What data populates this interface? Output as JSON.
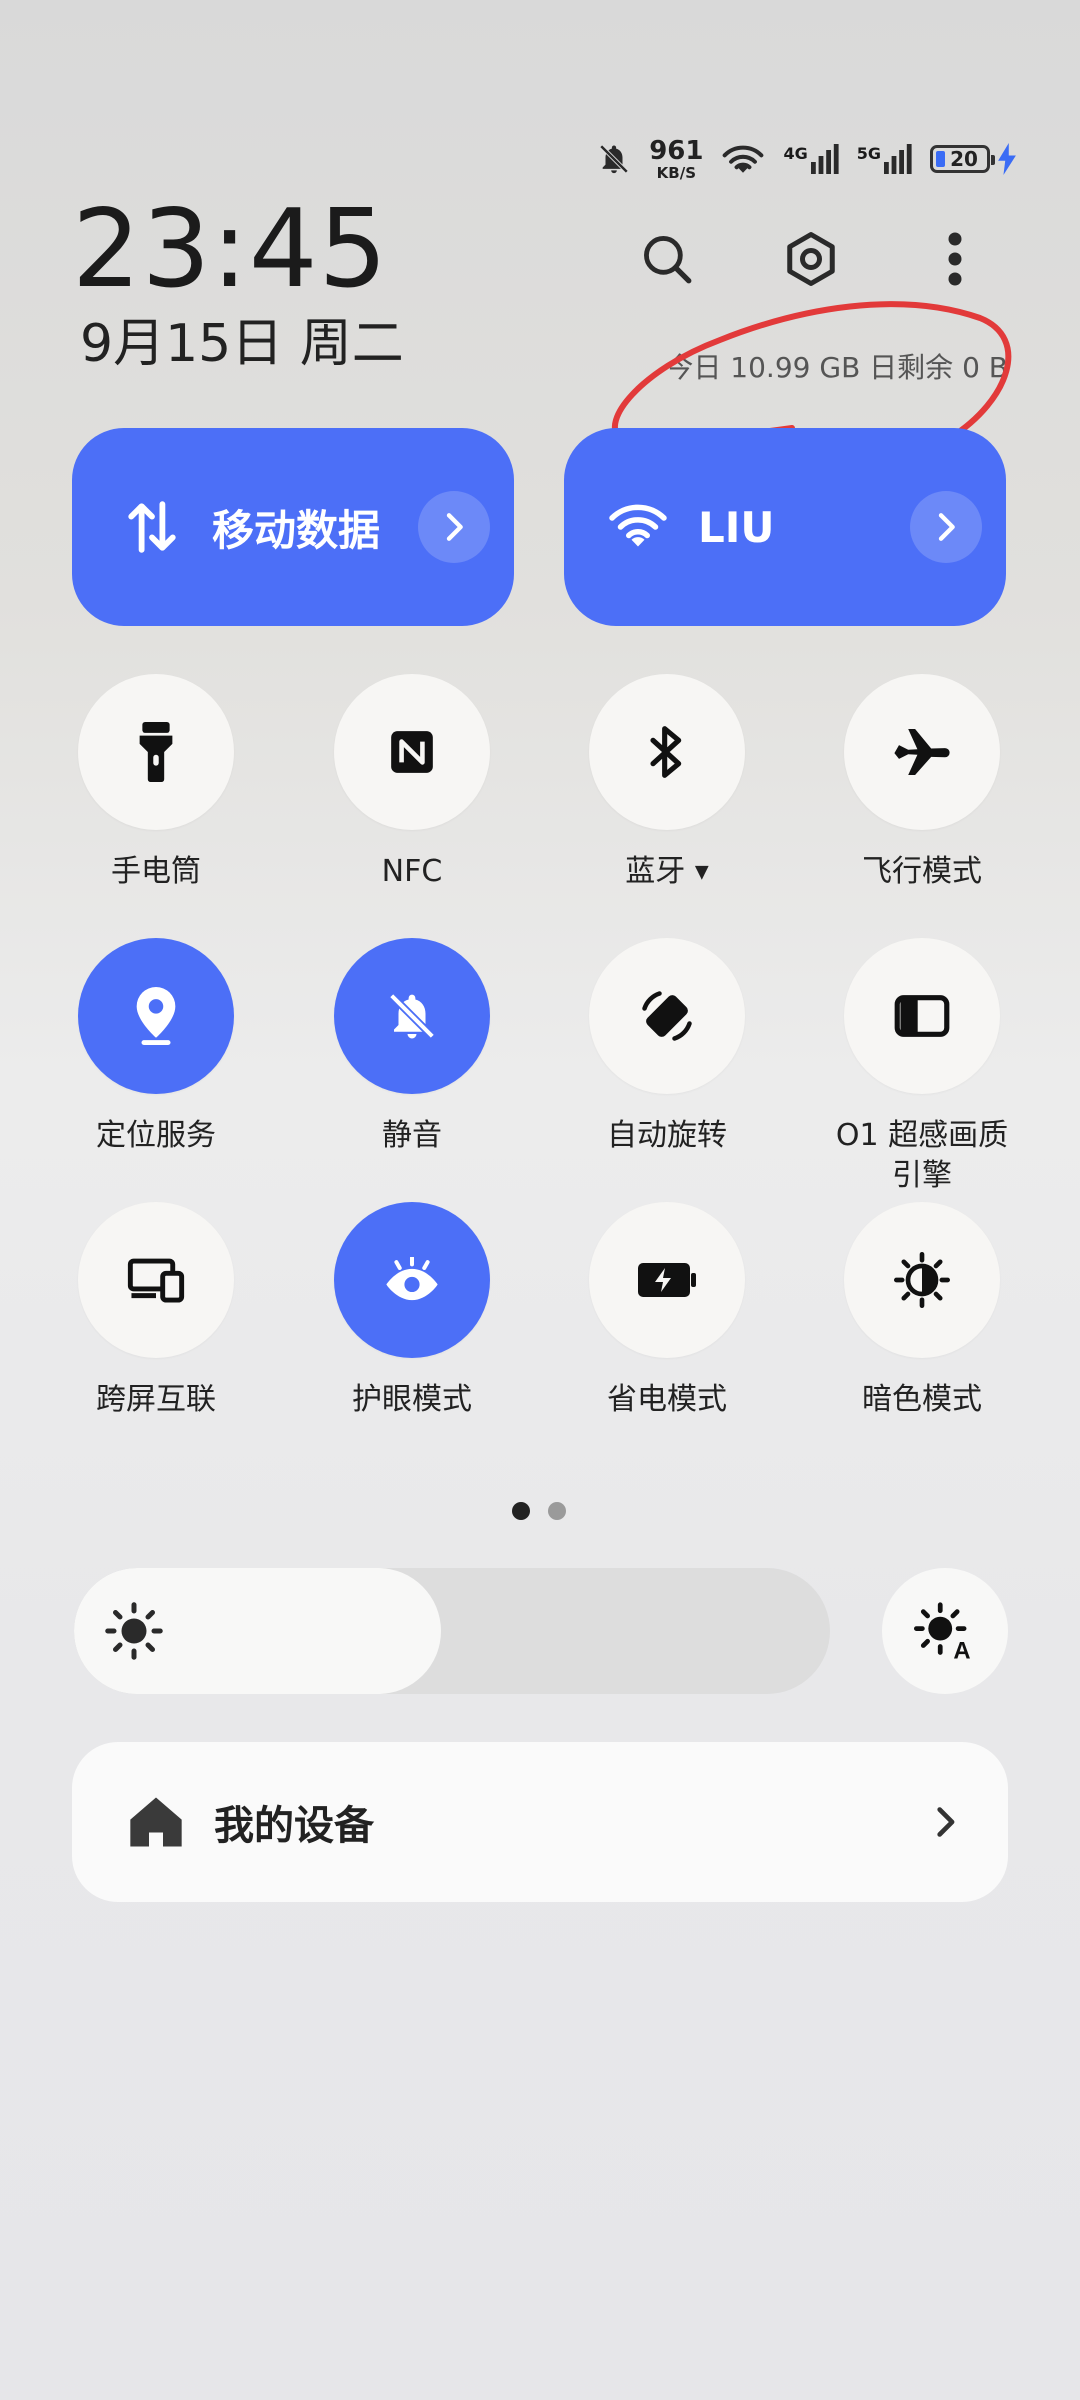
{
  "status_bar": {
    "net_speed_value": "961",
    "net_speed_unit": "KB/S",
    "net_4g": "4G",
    "net_5g": "5G",
    "battery_level": "20",
    "battery_charging": true
  },
  "header": {
    "time": "23:45",
    "date": "9月15日 周二",
    "data_usage": "今日 10.99 GB 日剩余 0 B"
  },
  "big_tiles": [
    {
      "label": "移动数据",
      "icon": "mobile-data-arrows-icon",
      "active": true
    },
    {
      "label": "LIU",
      "icon": "wifi-icon",
      "active": true
    }
  ],
  "tiles": [
    {
      "label": "手电筒",
      "icon": "flashlight-icon",
      "active": false
    },
    {
      "label": "NFC",
      "icon": "nfc-icon",
      "active": false
    },
    {
      "label": "蓝牙",
      "icon": "bluetooth-icon",
      "active": false,
      "has_dropdown": true
    },
    {
      "label": "飞行模式",
      "icon": "airplane-icon",
      "active": false
    },
    {
      "label": "定位服务",
      "icon": "location-icon",
      "active": true
    },
    {
      "label": "静音",
      "icon": "bell-off-icon",
      "active": true
    },
    {
      "label": "自动旋转",
      "icon": "auto-rotate-icon",
      "active": false
    },
    {
      "label": "O1 超感画质",
      "label2": "引擎",
      "icon": "display-engine-icon",
      "active": false
    },
    {
      "label": "跨屏互联",
      "icon": "multi-screen-icon",
      "active": false
    },
    {
      "label": "护眼模式",
      "icon": "eye-icon",
      "active": true
    },
    {
      "label": "省电模式",
      "icon": "battery-saver-icon",
      "active": false
    },
    {
      "label": "暗色模式",
      "icon": "dark-mode-icon",
      "active": false
    }
  ],
  "pager": {
    "pages": 2,
    "current": 1
  },
  "brightness": {
    "level": 0.485
  },
  "device_card": {
    "label": "我的设备"
  },
  "colors": {
    "accent": "#4c6ff7",
    "annotation": "#e23a3a"
  }
}
